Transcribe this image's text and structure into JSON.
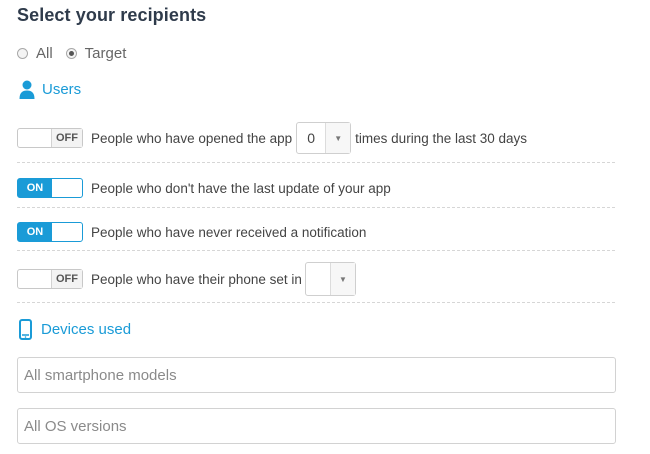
{
  "heading": "Select your recipients",
  "audience": {
    "options": [
      {
        "label": "All",
        "selected": false
      },
      {
        "label": "Target",
        "selected": true
      }
    ]
  },
  "users": {
    "title": "Users",
    "icon": "user-icon",
    "rules": [
      {
        "toggle": "OFF",
        "on": false,
        "text_before": "People who have opened the app",
        "select_value": "0",
        "text_after": "times during the last 30 days"
      },
      {
        "toggle": "ON",
        "on": true,
        "text_before": "People who don't have the last update of your app"
      },
      {
        "toggle": "ON",
        "on": true,
        "text_before": "People who have never received a notification"
      },
      {
        "toggle": "OFF",
        "on": false,
        "text_before": "People who have their phone set in",
        "select_value": ""
      }
    ]
  },
  "devices": {
    "title": "Devices used",
    "icon": "smartphone-icon",
    "models_placeholder": "All smartphone models",
    "os_placeholder": "All OS versions"
  },
  "colors": {
    "accent": "#1a9bd7",
    "heading": "#2f3b4b"
  }
}
